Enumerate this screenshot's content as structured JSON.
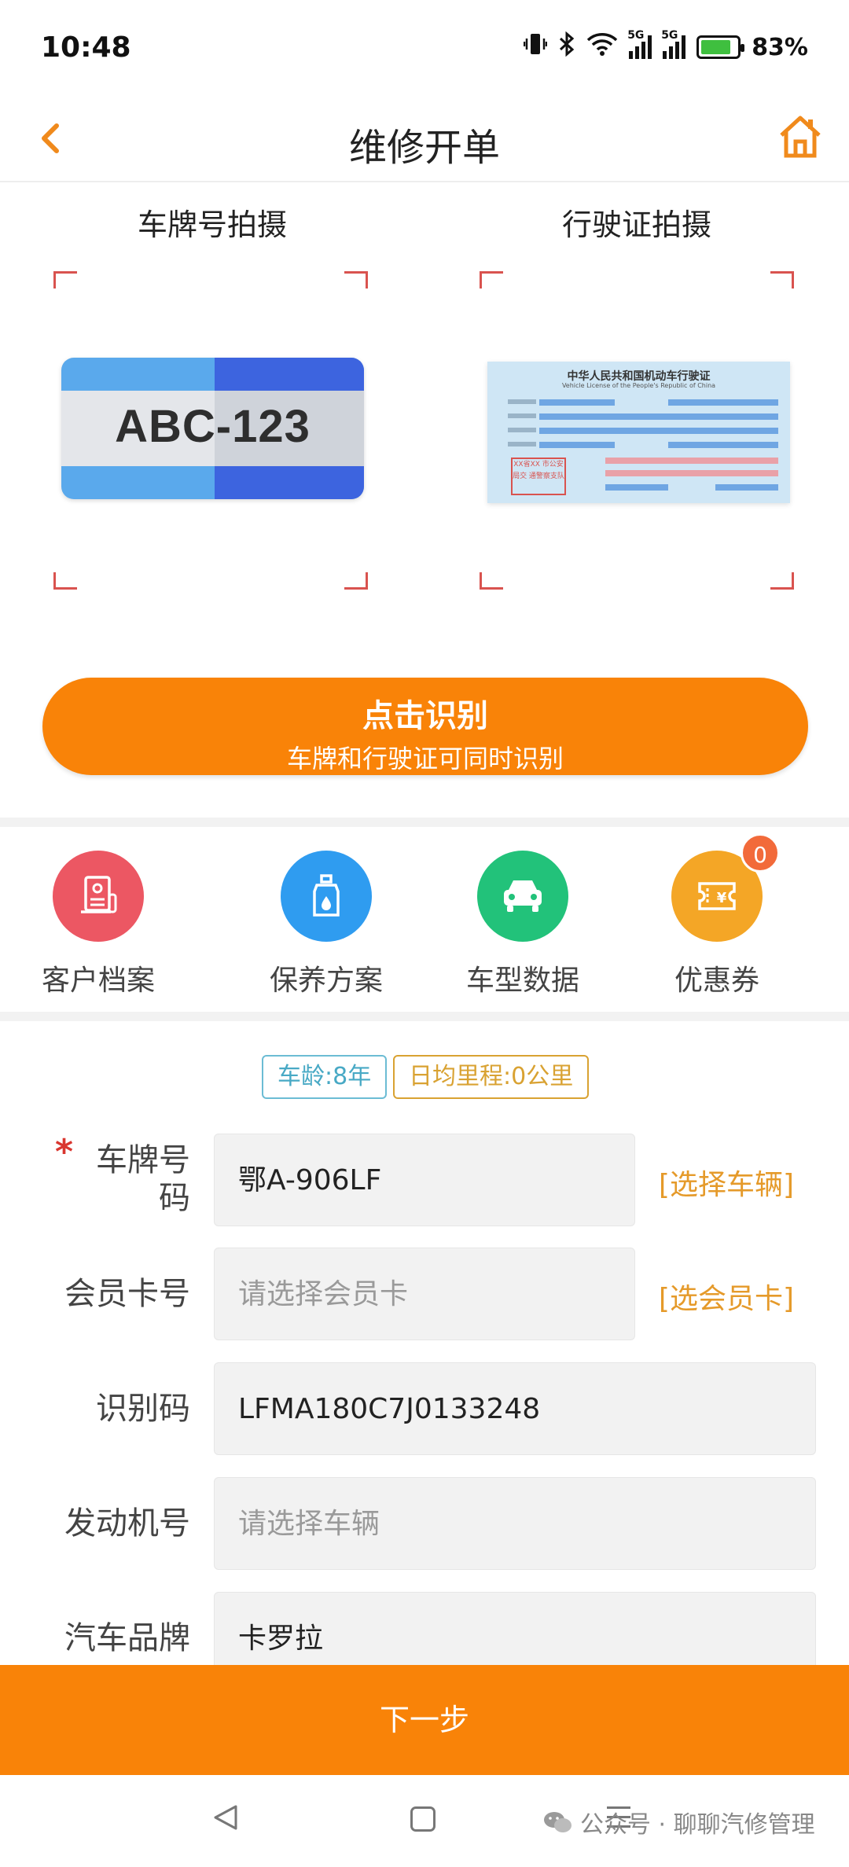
{
  "status_bar": {
    "time": "10:48",
    "battery": "83%",
    "battery_level": 0.83
  },
  "header": {
    "title": "维修开单",
    "back_icon": "chevron-left-icon",
    "home_icon": "home-icon",
    "accent_color": "#f98308"
  },
  "capture": {
    "plate_label": "车牌号拍摄",
    "license_label": "行驶证拍摄",
    "plate_sample_text": "ABC-123",
    "license_title": "中华人民共和国机动车行驶证",
    "license_subtitle": "Vehicle License of the People's Republic of China",
    "license_stamp": "XX省XX 市公安局交 通警察支队"
  },
  "recognize": {
    "title": "点击识别",
    "subtitle": "车牌和行驶证可同时识别"
  },
  "quick_menu": [
    {
      "label": "客户档案",
      "icon": "customer-file-icon",
      "color": "#ec5763"
    },
    {
      "label": "保养方案",
      "icon": "oil-bottle-icon",
      "color": "#2f9cf0"
    },
    {
      "label": "车型数据",
      "icon": "car-icon",
      "color": "#22c27a"
    },
    {
      "label": "优惠券",
      "icon": "coupon-icon",
      "color": "#f4a626",
      "badge": "0"
    }
  ],
  "tags": {
    "age": "车龄:8年",
    "mileage": "日均里程:0公里"
  },
  "form": {
    "required_mark": "*",
    "plate": {
      "label_line1": "车牌号",
      "label_line2": "码",
      "value": "鄂A-906LF",
      "action": "[选择车辆]"
    },
    "member_card": {
      "label": "会员卡号",
      "placeholder": "请选择会员卡",
      "action": "[选会员卡]"
    },
    "vin": {
      "label": "识别码",
      "value": "LFMA180C7J0133248"
    },
    "engine": {
      "label": "发动机号",
      "placeholder": "请选择车辆"
    },
    "brand": {
      "label": "汽车品牌",
      "value": "卡罗拉"
    }
  },
  "next_button": "下一步",
  "watermark": "公众号 · 聊聊汽修管理"
}
